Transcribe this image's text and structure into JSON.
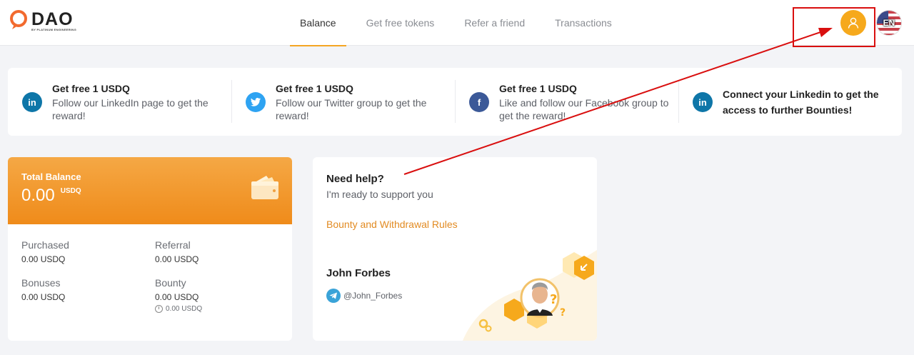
{
  "header": {
    "logo_word": "DAO",
    "logo_sub": "BY PLATINUM ENGINEERING",
    "tabs": [
      {
        "label": "Balance",
        "active": true
      },
      {
        "label": "Get free tokens",
        "active": false
      },
      {
        "label": "Refer a friend",
        "active": false
      },
      {
        "label": "Transactions",
        "active": false
      }
    ],
    "lang": "EN"
  },
  "bounties": [
    {
      "icon": "linkedin-icon",
      "color": "#0e76a8",
      "title": "Get free 1 USDQ",
      "desc": "Follow our LinkedIn page to get the reward!"
    },
    {
      "icon": "twitter-icon",
      "color": "#2ea3f2",
      "title": "Get free 1 USDQ",
      "desc": "Follow our Twitter group to get the reward!"
    },
    {
      "icon": "facebook-icon",
      "color": "#3b5998",
      "title": "Get free 1 USDQ",
      "desc": "Like and follow our Facebook group to get the reward!"
    },
    {
      "icon": "linkedin-icon",
      "color": "#0e76a8",
      "cta": "Connect your Linkedin to get the access to further Bounties!"
    }
  ],
  "balance": {
    "label": "Total Balance",
    "value": "0.00",
    "unit": "USDQ",
    "purchased_label": "Purchased",
    "purchased_value": "0.00 USDQ",
    "referral_label": "Referral",
    "referral_value": "0.00 USDQ",
    "bonuses_label": "Bonuses",
    "bonuses_value": "0.00 USDQ",
    "bounty_label": "Bounty",
    "bounty_value": "0.00 USDQ",
    "bounty_pending": "0.00 USDQ"
  },
  "help": {
    "title": "Need help?",
    "subtitle": "I'm ready to support you",
    "link": "Bounty and Withdrawal Rules",
    "name": "John Forbes",
    "telegram": "@John_Forbes"
  },
  "colors": {
    "accent": "#f5a623",
    "annotation": "#d90f0f"
  }
}
